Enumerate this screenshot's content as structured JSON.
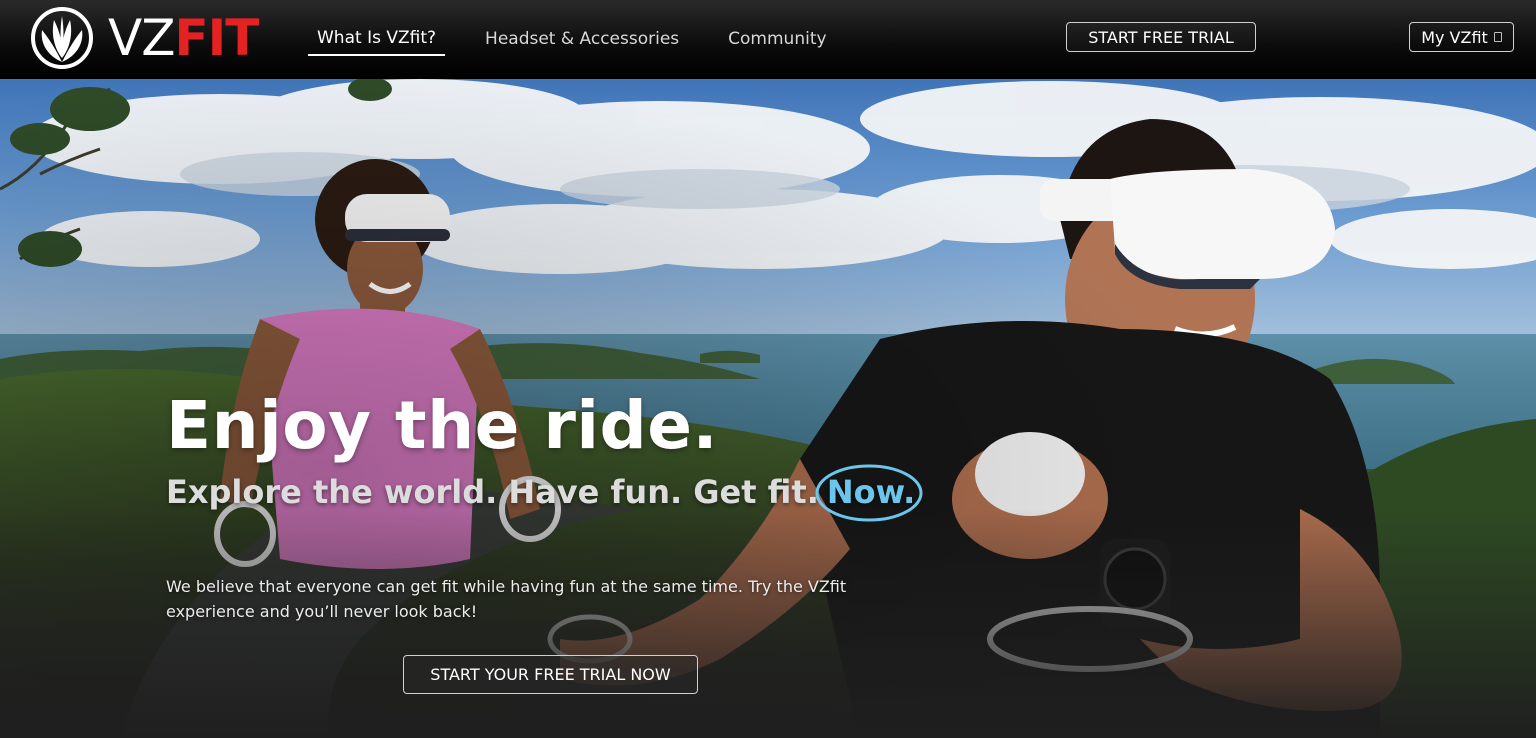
{
  "brand": {
    "name_part1": "VZ",
    "name_part2": "FIT",
    "accent_color": "#e42222"
  },
  "nav": {
    "links": [
      {
        "label": "What Is VZfit?",
        "active": true
      },
      {
        "label": "Headset & Accessories",
        "active": false
      },
      {
        "label": "Community",
        "active": false
      }
    ],
    "trial_button": "START FREE TRIAL",
    "account_button": "My VZfit",
    "account_icon": "caret-icon"
  },
  "hero": {
    "title": "Enjoy the ride.",
    "tagline": "Explore the world. Have fun. Get fit.",
    "tagline_highlight": "Now.",
    "highlight_color": "#6cc6ec",
    "body": "We believe that everyone can get fit while having fun at the same time. Try the VZfit experience and you’ll never look back!",
    "cta": "START YOUR FREE TRIAL NOW"
  }
}
